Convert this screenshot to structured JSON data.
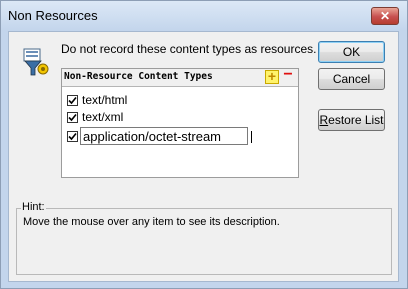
{
  "window": {
    "title": "Non Resources",
    "close_glyph": "✕"
  },
  "dialog": {
    "instruction": "Do not record these content types as resources.",
    "icon": "filter-icon",
    "list": {
      "header": "Non-Resource Content Types",
      "add_glyph": "+",
      "remove_glyph": "−",
      "items": [
        {
          "label": "text/html",
          "checked": true
        },
        {
          "label": "text/xml",
          "checked": true
        },
        {
          "label": "application/octet-stream",
          "checked": true,
          "editing": true
        }
      ]
    },
    "buttons": {
      "ok": "OK",
      "cancel": "Cancel",
      "restore_prefix": "R",
      "restore_rest": "estore List"
    },
    "hint": {
      "label": "Hint:",
      "text": "Move the mouse over any item to see its description."
    }
  },
  "colors": {
    "titlebar": "#c3d5ec",
    "close": "#c75050",
    "add": "#fff36b",
    "remove": "#e01010"
  }
}
